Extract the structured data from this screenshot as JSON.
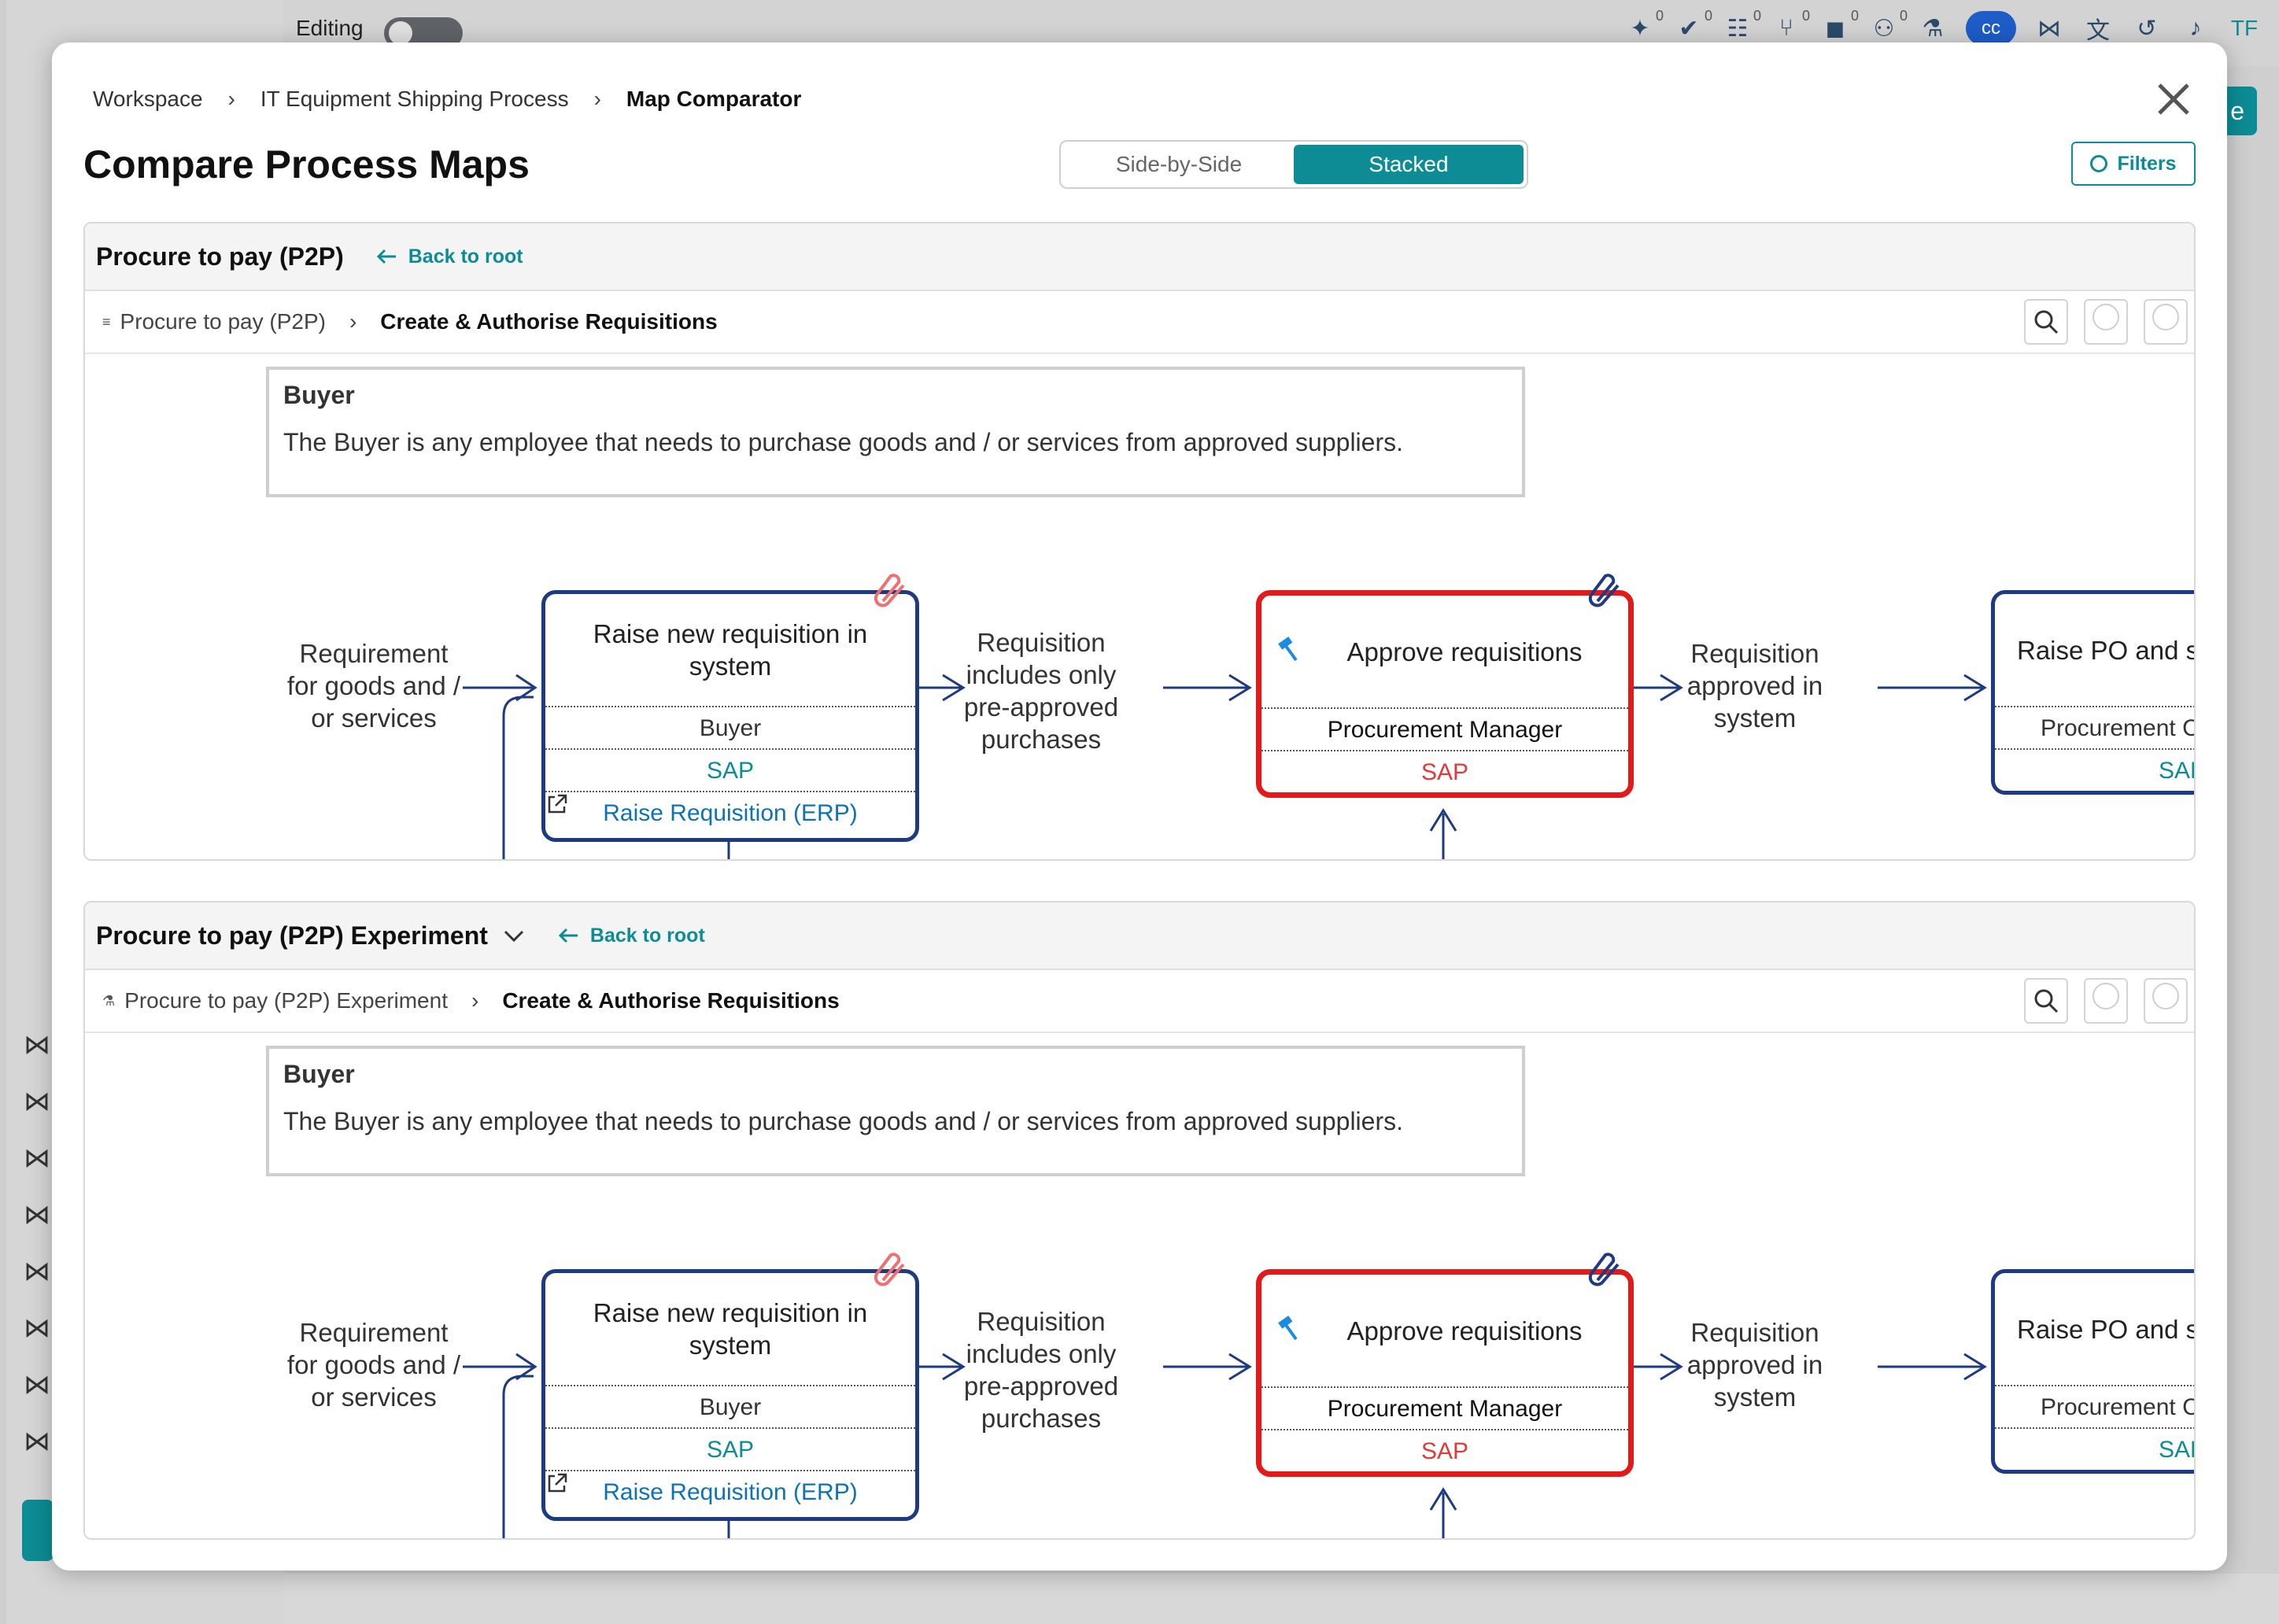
{
  "app": {
    "editing_label": "Editing",
    "toolbar_badges": [
      "0",
      "0",
      "0",
      "0",
      "0",
      "0"
    ],
    "avatar_initials": "cc",
    "user_initials": "TF",
    "right_button_label": "e"
  },
  "modal": {
    "breadcrumb": [
      "Workspace",
      "IT Equipment Shipping Process",
      "Map Comparator"
    ],
    "title": "Compare Process Maps",
    "view_options": [
      "Side-by-Side",
      "Stacked"
    ],
    "selected_view": "Stacked",
    "filters_label": "Filters"
  },
  "colors": {
    "accent": "#0e8c96",
    "node_border": "#1d3a82",
    "highlight": "#e31a1a"
  },
  "panels": [
    {
      "title": "Procure to pay (P2P)",
      "back_label": "Back to root",
      "sub_root": "Procure to pay (P2P)",
      "sub_current": "Create & Authorise Requisitions",
      "lane": {
        "title": "Buyer",
        "description": "The Buyer is any employee that needs to purchase goods and / or services from approved suppliers."
      },
      "events": [
        "Requirement for goods and / or services",
        "Requisition includes only pre-approved purchases",
        "Requisition approved in system"
      ],
      "nodes": [
        {
          "title": "Raise new requisition in system",
          "owner": "Buyer",
          "system": "SAP",
          "link": "Raise Requisition (ERP)"
        },
        {
          "title": "Approve requisitions",
          "owner": "Procurement Manager",
          "system": "SAP"
        },
        {
          "title": "Raise PO and se",
          "owner": "Procurement C",
          "system": "SAF"
        }
      ]
    },
    {
      "title": "Procure to pay (P2P) Experiment",
      "back_label": "Back to root",
      "sub_root": "Procure to pay (P2P) Experiment",
      "sub_current": "Create & Authorise Requisitions",
      "lane": {
        "title": "Buyer",
        "description": "The Buyer is any employee that needs to purchase goods and / or services from approved suppliers."
      },
      "events": [
        "Requirement for goods and / or services",
        "Requisition includes only pre-approved purchases",
        "Requisition approved in system"
      ],
      "nodes": [
        {
          "title": "Raise new requisition in system",
          "owner": "Buyer",
          "system": "SAP",
          "link": "Raise Requisition (ERP)"
        },
        {
          "title": "Approve requisitions",
          "owner": "Procurement Manager",
          "system": "SAP"
        },
        {
          "title": "Raise PO and se",
          "owner": "Procurement C",
          "system": "SAF"
        }
      ]
    }
  ]
}
